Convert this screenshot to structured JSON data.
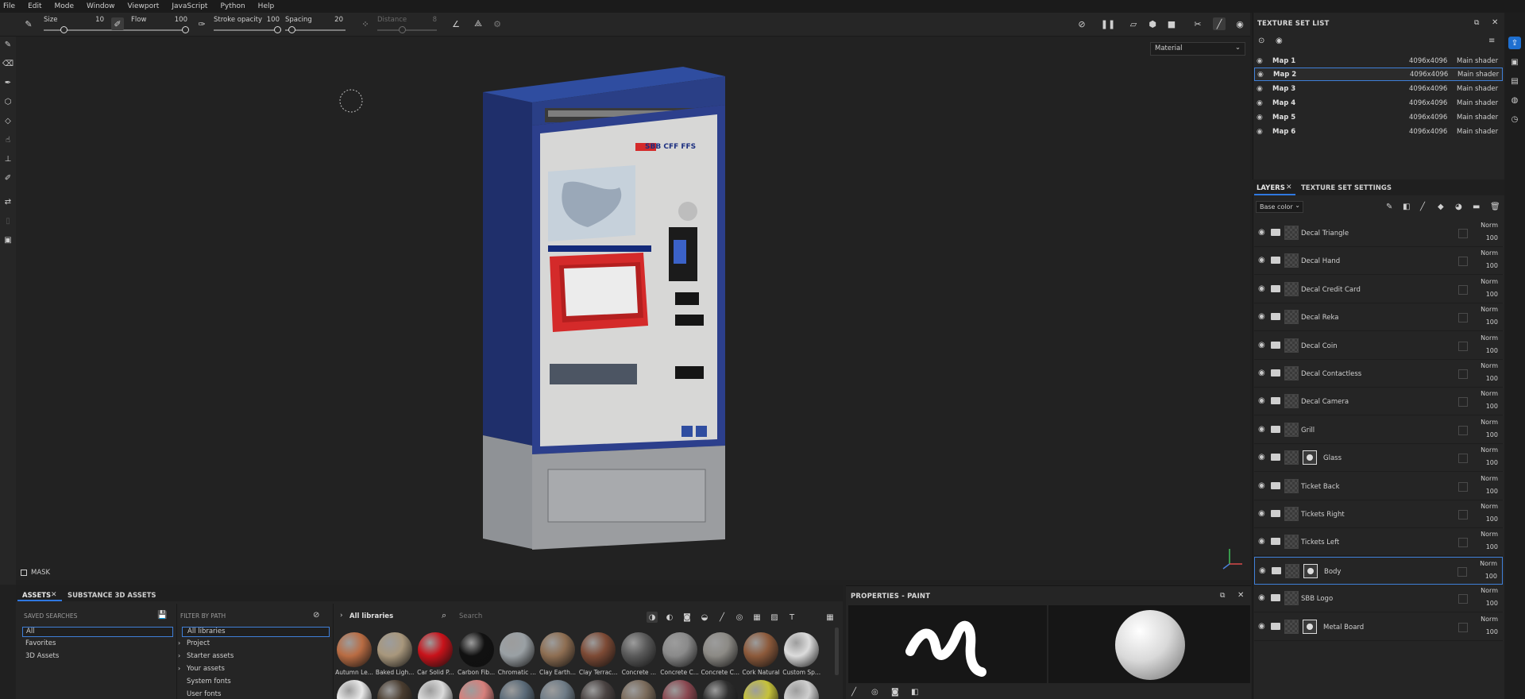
{
  "menu": [
    "File",
    "Edit",
    "Mode",
    "Window",
    "Viewport",
    "JavaScript",
    "Python",
    "Help"
  ],
  "toolbar": {
    "size_label": "Size",
    "size_value": "10",
    "flow_label": "Flow",
    "flow_value": "100",
    "stroke_label": "Stroke opacity",
    "stroke_value": "100",
    "spacing_label": "Spacing",
    "spacing_value": "20",
    "distance_label": "Distance",
    "distance_value": "8"
  },
  "viewport": {
    "material_select": "Material",
    "mask_label": "MASK",
    "machine_brand": "SBB CFF FFS"
  },
  "texture_set_list": {
    "title": "TEXTURE SET LIST",
    "rows": [
      {
        "name": "Map 1",
        "size": "4096x4096",
        "shader": "Main shader"
      },
      {
        "name": "Map 2",
        "size": "4096x4096",
        "shader": "Main shader"
      },
      {
        "name": "Map 3",
        "size": "4096x4096",
        "shader": "Main shader"
      },
      {
        "name": "Map 4",
        "size": "4096x4096",
        "shader": "Main shader"
      },
      {
        "name": "Map 5",
        "size": "4096x4096",
        "shader": "Main shader"
      },
      {
        "name": "Map 6",
        "size": "4096x4096",
        "shader": "Main shader"
      }
    ]
  },
  "layers_panel": {
    "tab_layers": "LAYERS",
    "tab_settings": "TEXTURE SET SETTINGS",
    "channel": "Base color",
    "blend": "Norm",
    "opacity": "100",
    "layers": [
      {
        "name": "Decal Triangle",
        "mask": false
      },
      {
        "name": "Decal Hand",
        "mask": false
      },
      {
        "name": "Decal Credit Card",
        "mask": false
      },
      {
        "name": "Decal Reka",
        "mask": false
      },
      {
        "name": "Decal Coin",
        "mask": false
      },
      {
        "name": "Decal Contactless",
        "mask": false
      },
      {
        "name": "Decal Camera",
        "mask": false
      },
      {
        "name": "Grill",
        "mask": false
      },
      {
        "name": "Glass",
        "mask": true
      },
      {
        "name": "Ticket Back",
        "mask": false
      },
      {
        "name": "Tickets Right",
        "mask": false
      },
      {
        "name": "Tickets Left",
        "mask": false
      },
      {
        "name": "Body",
        "mask": true
      },
      {
        "name": "SBB Logo",
        "mask": false
      },
      {
        "name": "Metal Board",
        "mask": true
      }
    ]
  },
  "assets": {
    "tab_assets": "ASSETS",
    "tab_s3d": "SUBSTANCE 3D ASSETS",
    "saved_searches_label": "SAVED SEARCHES",
    "saved_searches": [
      "All",
      "Favorites",
      "3D Assets"
    ],
    "filter_label": "FILTER BY PATH",
    "paths": [
      "All libraries",
      "Project",
      "Starter assets",
      "Your assets",
      "System fonts",
      "User fonts"
    ],
    "breadcrumb": "All libraries",
    "search_placeholder": "Search",
    "materials": [
      {
        "name": "Autumn Le...",
        "color": "#b96c43"
      },
      {
        "name": "Baked Ligh...",
        "color": "#a8977c"
      },
      {
        "name": "Car Solid P...",
        "color": "#c8121a"
      },
      {
        "name": "Carbon Fib...",
        "color": "#111111"
      },
      {
        "name": "Chromatic ...",
        "color": "#9aa0a4"
      },
      {
        "name": "Clay Earth...",
        "color": "#8e6e52"
      },
      {
        "name": "Clay Terrac...",
        "color": "#7d4a35"
      },
      {
        "name": "Concrete ...",
        "color": "#5a5a5a"
      },
      {
        "name": "Concrete C...",
        "color": "#8a8a8a"
      },
      {
        "name": "Concrete C...",
        "color": "#8c8a85"
      },
      {
        "name": "Cork Natural",
        "color": "#8d5a3b"
      },
      {
        "name": "Custom Sp...",
        "color": "#dcdcdc"
      }
    ],
    "materials_row2": [
      "#e9e9e9",
      "#4a3d30",
      "#dadada",
      "#d7807c",
      "#5b6b79",
      "#6f7c87",
      "#4a4342",
      "#7a6a5a",
      "#8a4750",
      "#2f2f2f",
      "#c6c23a",
      "#cfcfcf"
    ]
  },
  "properties": {
    "title": "PROPERTIES - PAINT"
  }
}
